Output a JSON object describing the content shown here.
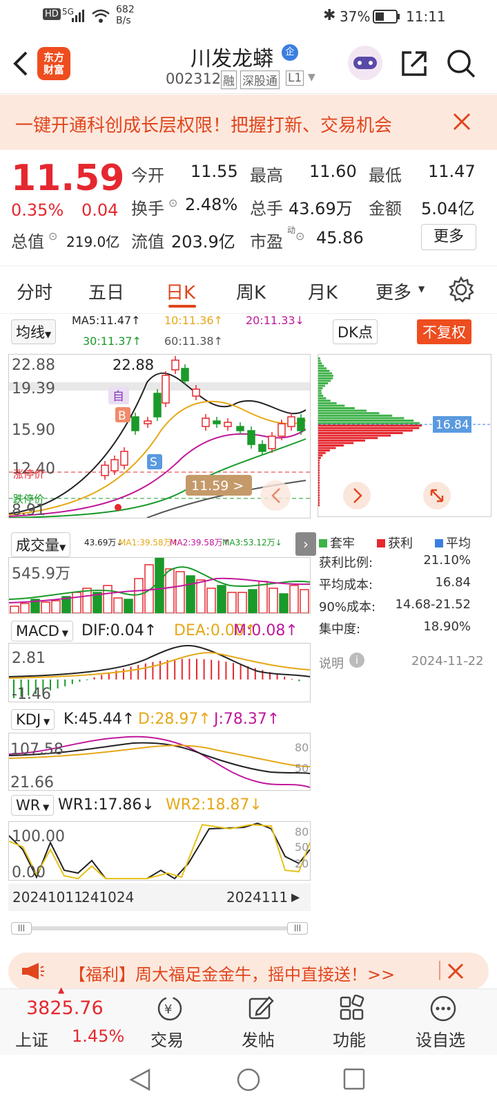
{
  "status_bar": {
    "net_left": "HD",
    "net_type": "5G",
    "speed": "682",
    "speed_unit": "B/s",
    "battery": "37%",
    "time": "11:11"
  },
  "header": {
    "logo_text_1": "东方",
    "logo_text_2": "财富",
    "stock_name": "川发龙蟒",
    "badge": "企",
    "code": "002312",
    "tags": [
      "融",
      "深股通",
      "L1"
    ]
  },
  "banner": {
    "text": "一键开通科创成长层权限！把握打新、交易机会"
  },
  "quote": {
    "price": "11.59",
    "change_pct": "0.35%",
    "change": "0.04",
    "open_label": "今开",
    "open": "11.55",
    "high_label": "最高",
    "high": "11.60",
    "low_label": "最低",
    "low": "11.47",
    "turnover_label": "换手",
    "turnover": "2.48%",
    "volume_label": "总手",
    "volume": "43.69万",
    "amount_label": "金额",
    "amount": "5.04亿",
    "mcap_label": "总值",
    "mcap": "219.0亿",
    "float_label": "流值",
    "float": "203.9亿",
    "pe_label": "市盈",
    "pe_sup": "动",
    "pe": "45.86",
    "more": "更多"
  },
  "tabs": [
    "分时",
    "五日",
    "日K",
    "周K",
    "月K",
    "更多"
  ],
  "active_tab": "日K",
  "kline": {
    "ma_select": "均线",
    "ma5": "MA5:11.47↑",
    "ma10": "10:11.36↑",
    "ma20": "20:11.33↓",
    "ma30": "30:11.37↑",
    "ma60": "60:11.38↑",
    "dk_button": "DK点",
    "fq_button": "不复权",
    "y_labels": [
      "22.88",
      "19.39",
      "15.90",
      "12.40",
      "8.91"
    ],
    "peak_label": "22.88",
    "price_tag": "11.59 >",
    "limit_down_label": "跌停价",
    "limit_up_label": "涨停价",
    "marker_b": "B",
    "marker_s": "S",
    "marker_zi": "自"
  },
  "chip_dist": {
    "avg_label": "16.84",
    "legend": [
      "套牢",
      "获利",
      "平均"
    ],
    "colors": {
      "trapped": "#3fb24a",
      "profit": "#e5282f",
      "avg": "#3b7ee0"
    },
    "stats": [
      {
        "label": "获利比例:",
        "value": "21.10%"
      },
      {
        "label": "平均成本:",
        "value": "16.84"
      },
      {
        "label": "90%成本:",
        "value": "14.68-21.52"
      },
      {
        "label": "集中度:",
        "value": "18.90%"
      }
    ],
    "note_label": "说明",
    "date": "2024-11-22"
  },
  "volume": {
    "select": "成交量",
    "vol": "43.69万↓",
    "ma1": "MA1:39.58万↑",
    "ma2": "MA2:39.58万↑",
    "ma3": "MA3:53.12万↓",
    "y_label": "545.9万"
  },
  "macd": {
    "select": "MACD",
    "dif": "DIF:0.04↑",
    "dea": "DEA:0.00↑",
    "m": "M:0.08↑",
    "y_top": "2.81",
    "y_bottom": "-1.46"
  },
  "kdj": {
    "select": "KDJ",
    "k": "K:45.44↑",
    "d": "D:28.97↑",
    "j": "J:78.37↑",
    "y_top": "107.58",
    "y_bottom": "21.66",
    "r80": "80",
    "r50": "50"
  },
  "wr": {
    "select": "WR",
    "wr1": "WR1:17.86↓",
    "wr2": "WR2:18.87↓",
    "y_top": "100.00",
    "y_bottom": "0.00",
    "r80": "80",
    "r50": "50",
    "r20": "20"
  },
  "dates": {
    "d1": "20241011",
    "d2": "241024",
    "d3": "2024111"
  },
  "promo": {
    "text": "【福利】周大福足金金牛，摇中直接送！>>"
  },
  "bottom_nav": {
    "index_value": "3825.76",
    "index_name": "上证",
    "index_pct": "1.45%",
    "items": [
      "交易",
      "发帖",
      "功能",
      "设自选"
    ]
  }
}
